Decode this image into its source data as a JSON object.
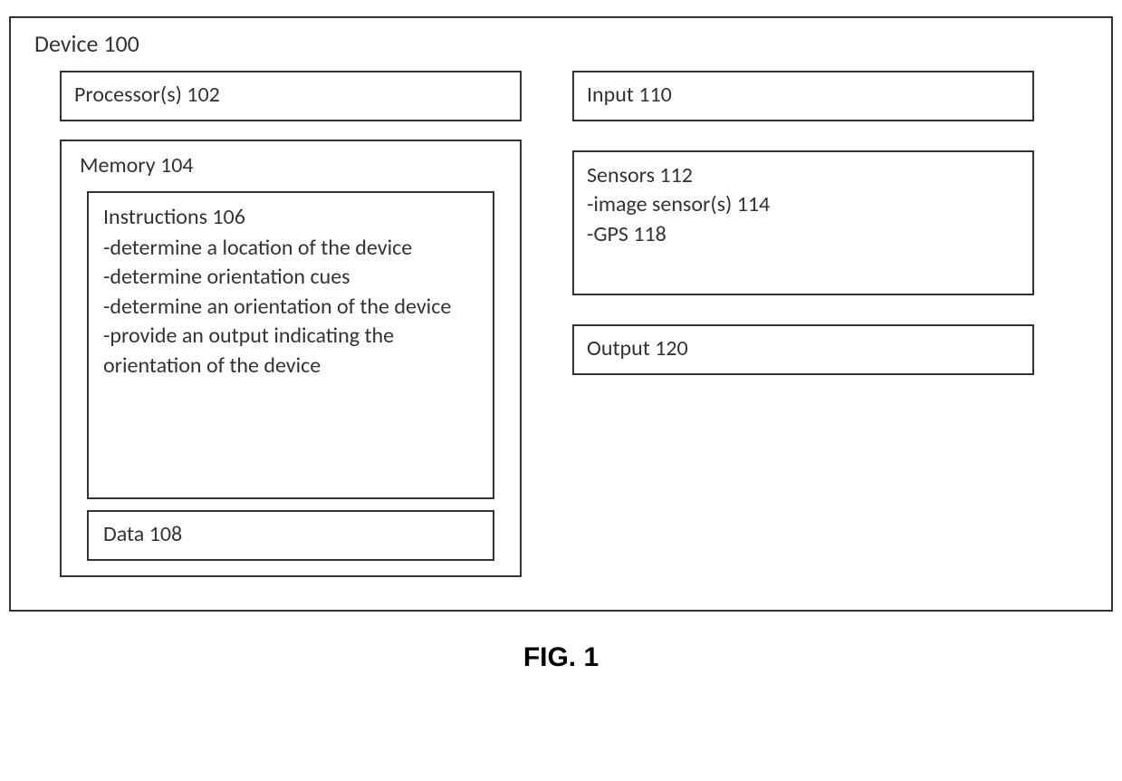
{
  "device": {
    "title": "Device 100",
    "processors": "Processor(s) 102",
    "memory": {
      "title": "Memory 104",
      "instructions": {
        "title": "Instructions 106",
        "items": {
          "0": "-determine a location of the device",
          "1": "-determine orientation cues",
          "2": "-determine an orientation of the device",
          "3": "-provide an output indicating the orientation of the device"
        }
      },
      "data": "Data 108"
    },
    "input": "Input 110",
    "sensors": {
      "title": "Sensors 112",
      "items": {
        "0": "-image sensor(s) 114",
        "1": "-GPS 118"
      }
    },
    "output": "Output 120"
  },
  "figure_label": "FIG. 1"
}
